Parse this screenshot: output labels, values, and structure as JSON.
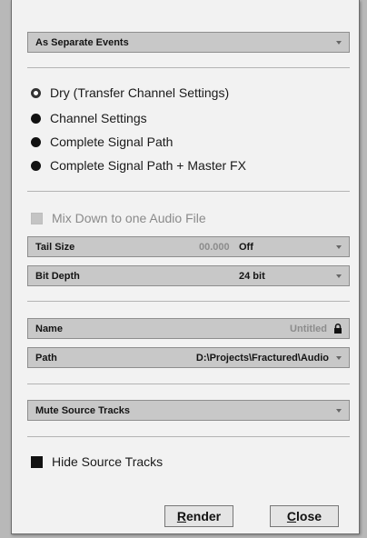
{
  "export_mode": {
    "value": "As Separate Events"
  },
  "channel_options": [
    {
      "label": "Dry (Transfer Channel Settings)",
      "selected": true
    },
    {
      "label": "Channel Settings",
      "selected": false
    },
    {
      "label": "Complete Signal Path",
      "selected": false
    },
    {
      "label": "Complete Signal Path + Master FX",
      "selected": false
    }
  ],
  "mixdown": {
    "label": "Mix Down to one Audio File",
    "enabled": false
  },
  "tail_size": {
    "label": "Tail Size",
    "value": "00.000",
    "mode": "Off"
  },
  "bit_depth": {
    "label": "Bit Depth",
    "value": "24 bit"
  },
  "name": {
    "label": "Name",
    "value": "Untitled"
  },
  "path": {
    "label": "Path",
    "value": "D:\\Projects\\Fractured\\Audio"
  },
  "mute_source": {
    "label": "Mute Source Tracks"
  },
  "hide_source": {
    "label": "Hide Source Tracks",
    "checked": true
  },
  "buttons": {
    "render_first": "R",
    "render_rest": "ender",
    "close_first": "C",
    "close_rest": "lose"
  }
}
